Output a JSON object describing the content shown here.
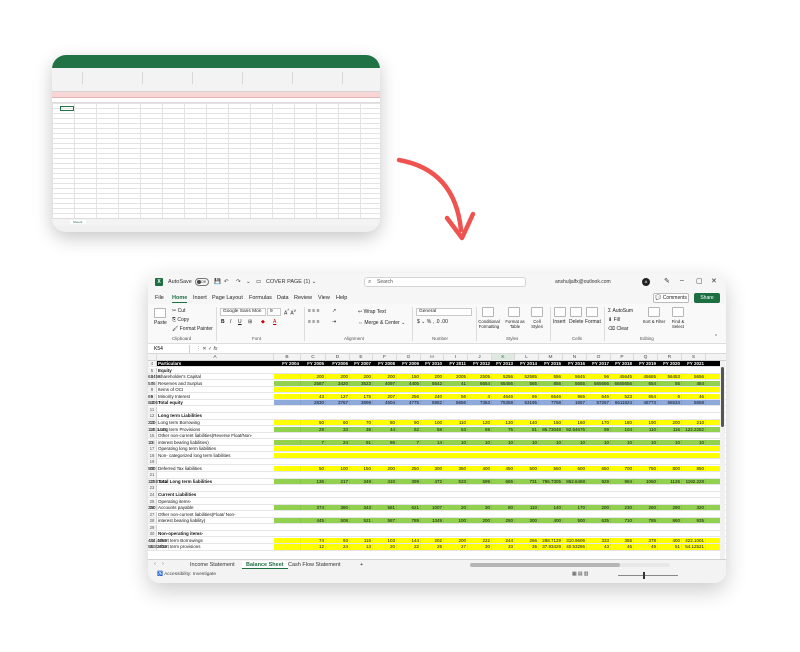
{
  "small_window": {
    "sheet_tab": "Sheet1"
  },
  "colors": {
    "accent": "#1d6f42",
    "yellow": "#ffff00",
    "green": "#92d050",
    "blue": "#8eaadb",
    "header": "#000000",
    "arrow": "#ef5350"
  },
  "titlebar": {
    "autosave_label": "AutoSave",
    "autosave_state": "Off",
    "doc_title": "COVER PAGE (1) ⌄",
    "search_placeholder": "Search",
    "account_email": "anshuljalfx@outlook.com",
    "avatar_initial": "A"
  },
  "menu": {
    "items": [
      "File",
      "Home",
      "Insert",
      "Page Layout",
      "Formulas",
      "Data",
      "Review",
      "View",
      "Help"
    ],
    "comments_label": "Comments",
    "share_label": "Share"
  },
  "ribbon": {
    "paste": "Paste",
    "cut": "Cut",
    "copy": "Copy",
    "format_painter": "Format Painter",
    "font_name": "Google Sans Mon",
    "font_size": "9",
    "wrap_text": "Wrap Text",
    "merge_center": "Merge & Center",
    "number_format": "General",
    "conditional_formatting": "Conditional Formatting",
    "format_as_table": "Format as Table",
    "cell_styles": "Cell Styles",
    "insert": "Insert",
    "delete": "Delete",
    "format": "Format",
    "autosum": "AutoSum",
    "fill": "Fill",
    "clear": "Clear",
    "sort_filter": "Sort & Filter",
    "find_select": "Find & Select",
    "groups": [
      "Clipboard",
      "Font",
      "Alignment",
      "Number",
      "Styles",
      "Cells",
      "Editing"
    ]
  },
  "formula_bar": {
    "name_box": "K54",
    "fx": "fx"
  },
  "sheet": {
    "columns": [
      "A",
      "B",
      "C",
      "D",
      "E",
      "F",
      "G",
      "H",
      "I",
      "J",
      "K",
      "L",
      "M",
      "N",
      "O",
      "P",
      "Q",
      "R",
      "S"
    ],
    "selected_column": "K",
    "rows": [
      {
        "n": "4",
        "label": "Particulars",
        "fill": "header",
        "bold": true,
        "cells": [
          "FY 2004",
          "FY 2005",
          "FY2006",
          "FY 2007",
          "FY 2008",
          "FY 2009",
          "FY 2010",
          "FY 2011",
          "FY 2012",
          "FY 2013",
          "FY 2014",
          "FY 2015",
          "FY 2016",
          "FY 2017",
          "FY 2018",
          "FY 2019",
          "FY 2020",
          "FY 2021"
        ]
      },
      {
        "n": "5",
        "label": "Equity",
        "fill": "none",
        "bold": true,
        "cells": []
      },
      {
        "n": "6",
        "label": "Shareholder's Capital",
        "fill": "yellow",
        "bold": false,
        "cells": [
          "",
          "200",
          "200",
          "200",
          "200",
          "150",
          "200",
          "2005",
          "2505",
          "5256",
          "52585",
          "556",
          "5645",
          "56",
          "45645",
          "45665",
          "56453",
          "5656",
          "63456"
        ]
      },
      {
        "n": "7",
        "label": "Reserves and Surplus",
        "fill": "green",
        "bold": false,
        "cells": [
          "",
          "2587",
          "3420",
          "3523",
          "4097",
          "4405",
          "5542",
          "41",
          "6654",
          "65456",
          "565",
          "856",
          "5655",
          "565656",
          "6565656",
          "654",
          "55",
          "484",
          "546"
        ]
      },
      {
        "n": "8",
        "label": "Items of OCI",
        "fill": "yellow",
        "bold": false,
        "cells": []
      },
      {
        "n": "9",
        "label": "Minority Interest",
        "fill": "yellow",
        "bold": false,
        "cells": [
          "",
          "43",
          "127",
          "175",
          "207",
          "256",
          "240",
          "56",
          "4",
          "4646",
          "65",
          "6546",
          "965",
          "645",
          "523",
          "654",
          "6",
          "46",
          "65"
        ]
      },
      {
        "n": "10",
        "label": "Total equity",
        "fill": "blue",
        "bold": true,
        "cells": [
          "",
          "2830",
          "3767",
          "3898",
          "4504",
          "4775",
          "5982",
          "5656",
          "7363",
          "75358",
          "53195",
          "7758",
          "1657",
          "57267",
          "6611824",
          "46773",
          "56534",
          "5658",
          "64067"
        ]
      },
      {
        "n": "11",
        "label": "",
        "fill": "none",
        "bold": false,
        "cells": []
      },
      {
        "n": "12",
        "label": "Long term Liabilities",
        "fill": "none",
        "bold": true,
        "cells": []
      },
      {
        "n": "13",
        "label": "Long term Borrowing",
        "fill": "yellow",
        "bold": false,
        "cells": [
          "",
          "50",
          "60",
          "70",
          "80",
          "90",
          "100",
          "110",
          "120",
          "130",
          "140",
          "150",
          "160",
          "170",
          "180",
          "190",
          "200",
          "210",
          "220"
        ]
      },
      {
        "n": "14",
        "label": "Long term Provisions",
        "fill": "green",
        "bold": false,
        "cells": [
          "",
          "29",
          "33",
          "38",
          "44",
          "52",
          "58",
          "63",
          "69",
          "75",
          "81",
          "86.73048",
          "92.54676",
          "99",
          "104",
          "110",
          "116",
          "122.2282",
          "128.1445"
        ]
      },
      {
        "n": "15",
        "label": "Other non-current liabilities(Reverse Float/Non-",
        "fill": "none",
        "bold": false,
        "cells": []
      },
      {
        "n": "16",
        "label": "interest bearing liabilities)",
        "fill": "green",
        "bold": false,
        "cells": [
          "",
          "7",
          "24",
          "91",
          "86",
          "7",
          "14",
          "10",
          "10",
          "10",
          "10",
          "10",
          "10",
          "10",
          "10",
          "10",
          "10",
          "10",
          "10"
        ]
      },
      {
        "n": "17",
        "label": "Operating long term liabilities",
        "fill": "yellow",
        "bold": false,
        "cells": []
      },
      {
        "n": "18",
        "label": "Non- categorized long term liabilities",
        "fill": "yellow",
        "bold": false,
        "cells": []
      },
      {
        "n": "19",
        "label": "",
        "fill": "none",
        "bold": false,
        "cells": []
      },
      {
        "n": "20",
        "label": "Deferred Tax liabilities",
        "fill": "yellow",
        "bold": false,
        "cells": [
          "",
          "50",
          "100",
          "150",
          "200",
          "250",
          "300",
          "350",
          "400",
          "450",
          "500",
          "550",
          "600",
          "650",
          "700",
          "750",
          "800",
          "850",
          "900"
        ]
      },
      {
        "n": "21",
        "label": "",
        "fill": "none",
        "bold": false,
        "cells": []
      },
      {
        "n": "22",
        "label": "Total Long term liabilities",
        "fill": "green",
        "bold": true,
        "cells": [
          "",
          "136",
          "217",
          "349",
          "410",
          "399",
          "472",
          "533",
          "599",
          "665",
          "731",
          "796.7305",
          "862.6468",
          "929",
          "994",
          "1060",
          "1126",
          "1192.228",
          "1258.144"
        ]
      },
      {
        "n": "23",
        "label": "",
        "fill": "none",
        "bold": false,
        "cells": []
      },
      {
        "n": "24",
        "label": "Current Liabilities",
        "fill": "none",
        "bold": true,
        "cells": []
      },
      {
        "n": "25",
        "label": "Operating items-",
        "fill": "none",
        "bold": false,
        "cells": []
      },
      {
        "n": "26",
        "label": "Accounts payable",
        "fill": "green",
        "bold": false,
        "cells": [
          "",
          "374",
          "380",
          "343",
          "581",
          "621",
          "1007",
          "20",
          "30",
          "80",
          "110",
          "140",
          "170",
          "200",
          "230",
          "260",
          "290",
          "320",
          "350"
        ]
      },
      {
        "n": "27",
        "label": "Other non-current liabilities(Float/ Non-",
        "fill": "none",
        "bold": false,
        "cells": []
      },
      {
        "n": "28",
        "label": "interest bearing liability)",
        "fill": "green",
        "bold": false,
        "cells": [
          "",
          "445",
          "508",
          "521",
          "587",
          "789",
          "1349",
          "100",
          "200",
          "250",
          "300",
          "400",
          "500",
          "635",
          "710",
          "785",
          "860",
          "935"
        ]
      },
      {
        "n": "29",
        "label": "",
        "fill": "none",
        "bold": false,
        "cells": []
      },
      {
        "n": "30",
        "label": "Non-operating items-",
        "fill": "none",
        "bold": true,
        "cells": []
      },
      {
        "n": "31",
        "label": "Short term Borrowings",
        "fill": "yellow",
        "bold": false,
        "cells": [
          "",
          "74",
          "93",
          "115",
          "103",
          "144",
          "202",
          "200",
          "222",
          "244",
          "266",
          "288.7129",
          "310.9606",
          "333",
          "355",
          "378",
          "400",
          "422.1001",
          "444.4469"
        ]
      },
      {
        "n": "32",
        "label": "Short term provisions",
        "fill": "yellow",
        "bold": false,
        "cells": [
          "",
          "12",
          "24",
          "13",
          "20",
          "22",
          "25",
          "27",
          "30",
          "33",
          "35",
          "37.93429",
          "40.53286",
          "43",
          "46",
          "49",
          "51",
          "54.12521",
          "56.82439"
        ]
      }
    ]
  },
  "tabs": {
    "sheets": [
      "Income Statement",
      "Balance Sheet",
      "Cash Flow Statement"
    ],
    "active": "Balance Sheet",
    "add": "+"
  },
  "status": {
    "accessibility": "Accessibility: Investigate"
  }
}
